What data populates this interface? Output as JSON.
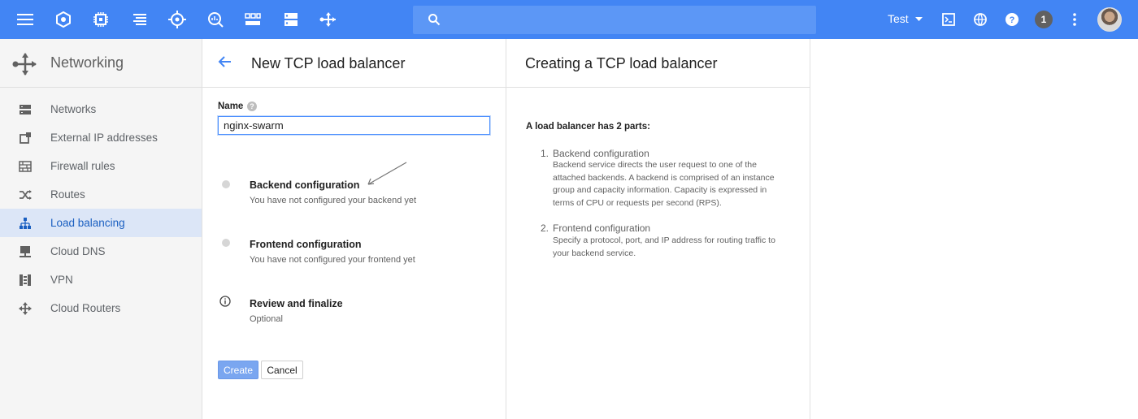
{
  "topbar": {
    "search_placeholder": "",
    "project_name": "Test",
    "notification_count": "1"
  },
  "sidebar": {
    "title": "Networking",
    "items": [
      {
        "label": "Networks",
        "icon": "networks-icon"
      },
      {
        "label": "External IP addresses",
        "icon": "external-ip-icon"
      },
      {
        "label": "Firewall rules",
        "icon": "firewall-icon"
      },
      {
        "label": "Routes",
        "icon": "routes-icon"
      },
      {
        "label": "Load balancing",
        "icon": "load-balancing-icon",
        "active": true
      },
      {
        "label": "Cloud DNS",
        "icon": "cloud-dns-icon"
      },
      {
        "label": "VPN",
        "icon": "vpn-icon"
      },
      {
        "label": "Cloud Routers",
        "icon": "cloud-routers-icon"
      }
    ]
  },
  "form": {
    "title": "New TCP load balancer",
    "name_label": "Name",
    "name_value": "nginx-swarm",
    "steps": [
      {
        "title": "Backend configuration",
        "subtitle": "You have not configured your backend yet"
      },
      {
        "title": "Frontend configuration",
        "subtitle": "You have not configured your frontend yet"
      },
      {
        "title": "Review and finalize",
        "subtitle": "Optional"
      }
    ],
    "create_label": "Create",
    "cancel_label": "Cancel"
  },
  "help": {
    "title": "Creating a TCP load balancer",
    "intro": "A load balancer has 2 parts:",
    "items": [
      {
        "num": "1.",
        "title": "Backend configuration",
        "desc": "Backend service directs the user request to one of the attached backends. A backend is comprised of an instance group and capacity information. Capacity is expressed in terms of CPU or requests per second (RPS)."
      },
      {
        "num": "2.",
        "title": "Frontend configuration",
        "desc": "Specify a protocol, port, and IP address for routing traffic to your backend service."
      }
    ]
  },
  "colors": {
    "topbar": "#4285f4",
    "active_nav_bg": "#dce6f7",
    "active_nav_text": "#1a5fc1"
  }
}
